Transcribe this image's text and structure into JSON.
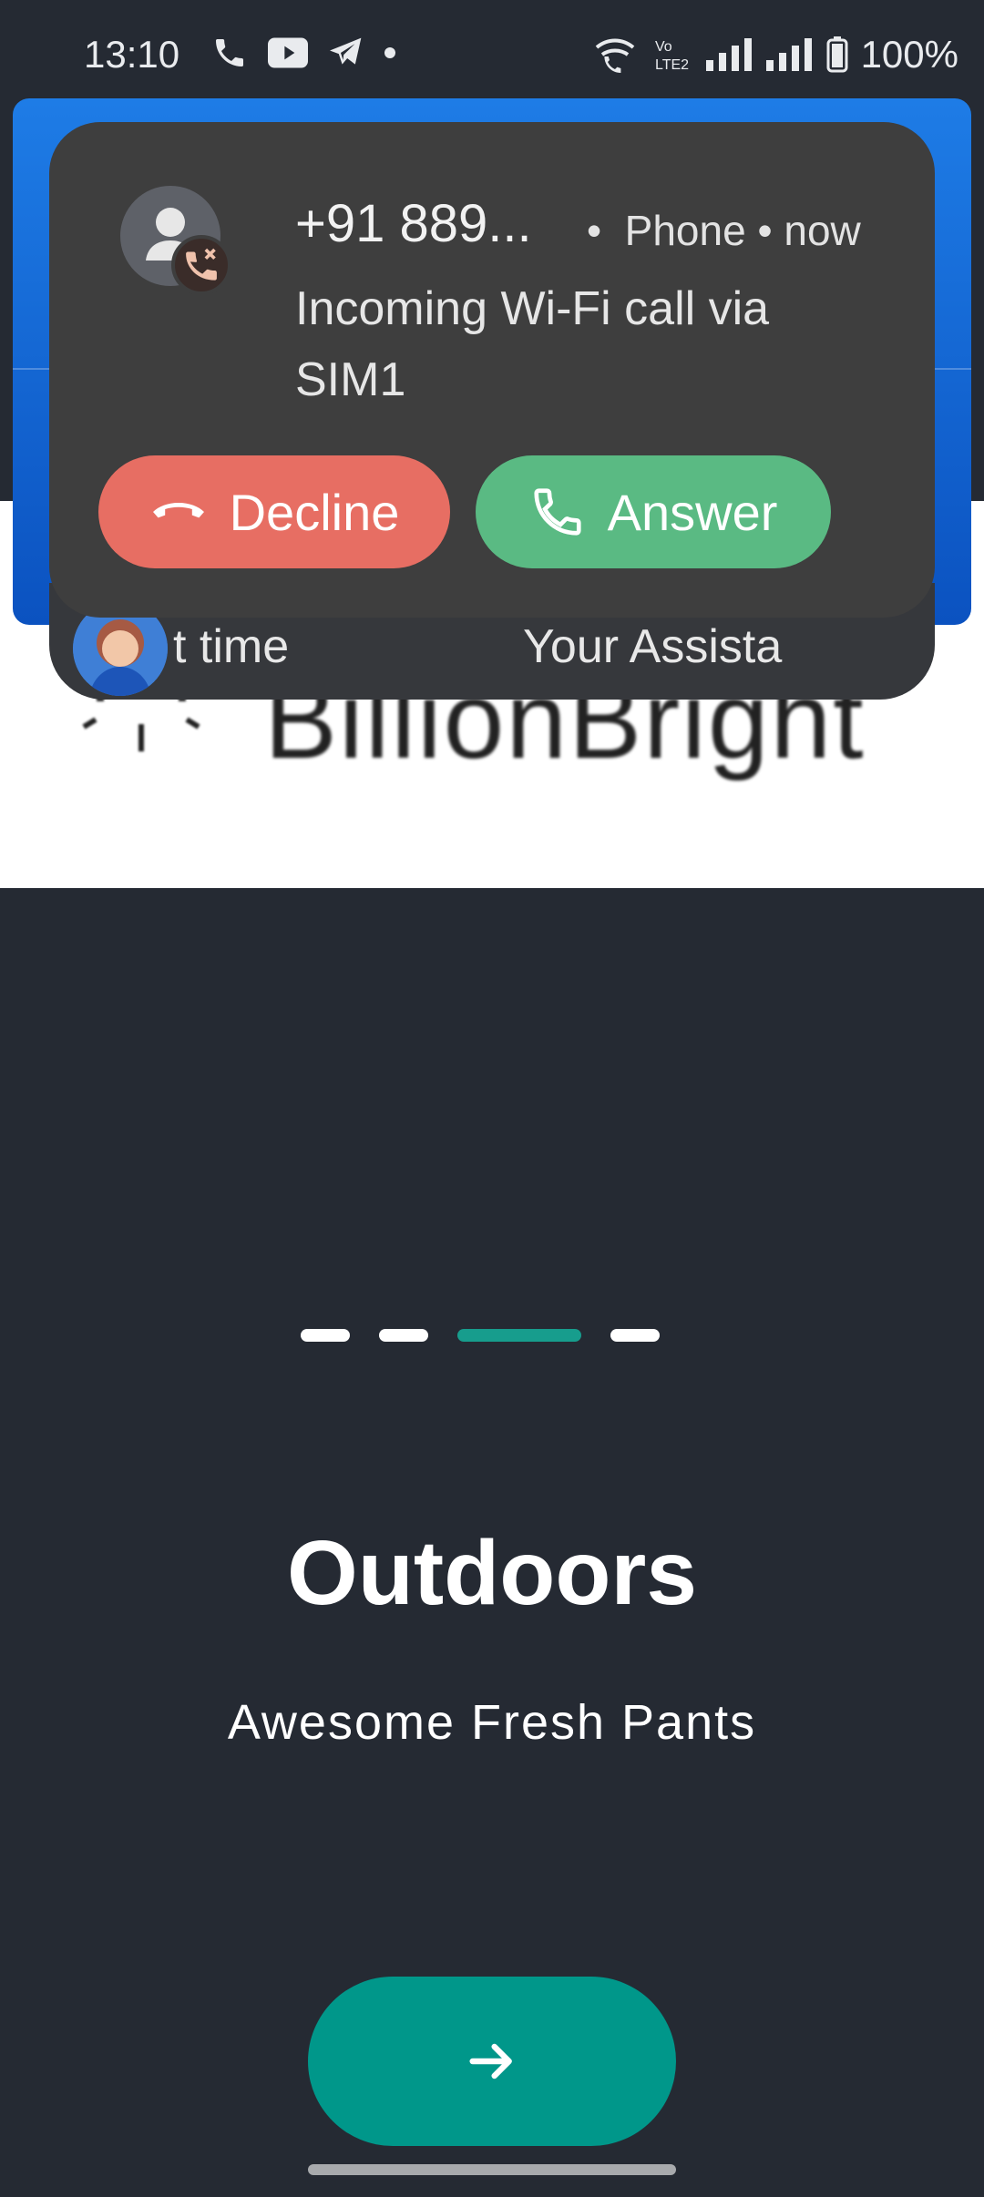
{
  "status_bar": {
    "time": "13:10",
    "battery": "100%",
    "left_icons": [
      "wifi-call-icon",
      "youtube-icon",
      "telegram-icon",
      "dot-icon"
    ],
    "right_icons": [
      "wifi-calling-icon",
      "volte-icon",
      "signal-icon",
      "signal-icon",
      "battery-icon"
    ]
  },
  "notification": {
    "caller": "+91 889...",
    "app": "Phone",
    "time": "now",
    "body": "Incoming Wi-Fi call via SIM1",
    "decline_label": "Decline",
    "answer_label": "Answer"
  },
  "assistant_chip": {
    "left_text": "t time",
    "right_text": "Your Assista"
  },
  "logo": {
    "text": "BillionBright"
  },
  "onboarding": {
    "title": "Outdoors",
    "subtitle": "Awesome Fresh Pants",
    "page_count": 4,
    "active_page": 3
  },
  "colors": {
    "background": "#252a33",
    "accent": "#00978a",
    "decline": "#e76e63",
    "answer": "#5aba83"
  }
}
